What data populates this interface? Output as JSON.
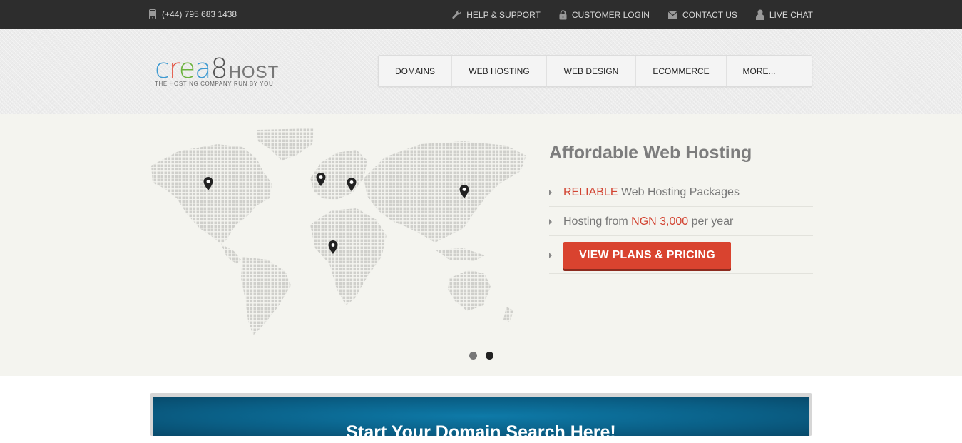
{
  "topbar": {
    "phone": "(+44) 795 683 1438",
    "links": [
      {
        "label": "HELP & SUPPORT",
        "icon": "wrench-icon"
      },
      {
        "label": "CUSTOMER LOGIN",
        "icon": "lock-icon"
      },
      {
        "label": "CONTACT US",
        "icon": "envelope-icon"
      },
      {
        "label": "LIVE CHAT",
        "icon": "user-icon"
      }
    ]
  },
  "logo": {
    "crea": "crea",
    "eight": "8",
    "host": "HOST",
    "tagline": "THE HOSTING COMPANY RUN BY YOU"
  },
  "nav": {
    "items": [
      "DOMAINS",
      "WEB HOSTING",
      "WEB DESIGN",
      "ECOMMERCE",
      "MORE..."
    ]
  },
  "hero": {
    "title": "Affordable Web Hosting",
    "feature1_highlight": "RELIABLE",
    "feature1_rest": "Web Hosting Packages",
    "feature2_pre": "Hosting from",
    "feature2_highlight": "NGN 3,000",
    "feature2_post": "per year",
    "cta": "VIEW PLANS & PRICING",
    "slides_total": 2,
    "active_slide": 2
  },
  "search": {
    "title": "Start Your Domain Search Here!"
  },
  "colors": {
    "topbar": "#2d2d2d",
    "accent_red": "#d9432f",
    "search_blue": "#0a5f86"
  }
}
